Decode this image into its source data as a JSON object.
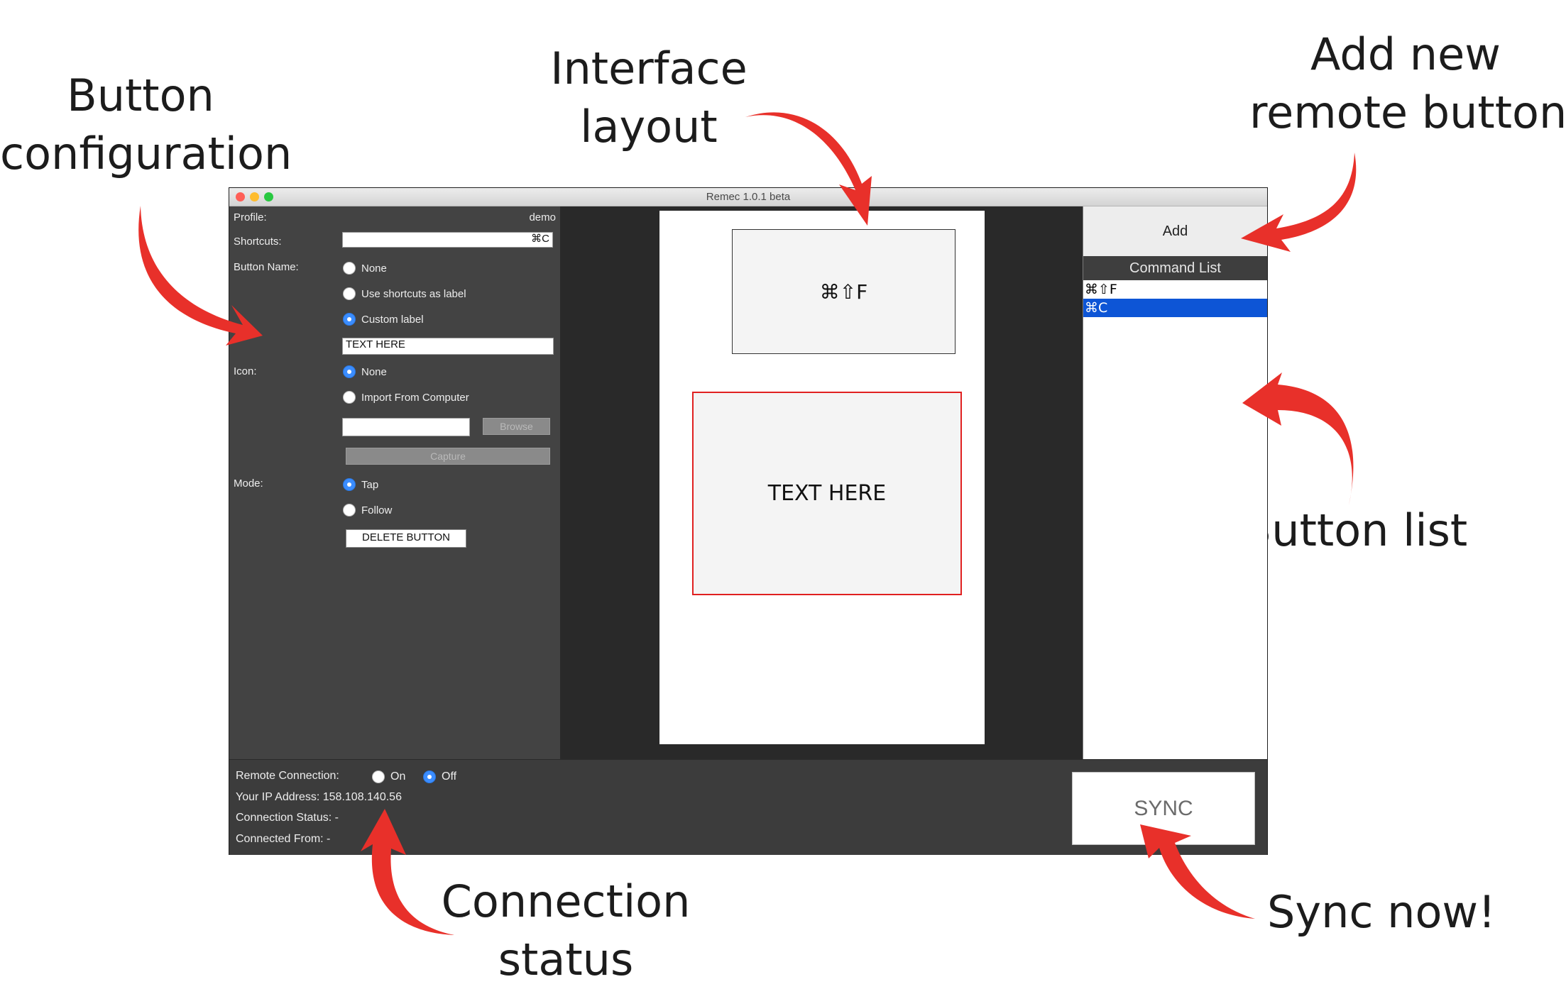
{
  "annotations": {
    "button_configuration": [
      "Button",
      "configuration"
    ],
    "interface_layout": [
      "Interface",
      "layout"
    ],
    "add_new_remote_button": [
      "Add new",
      "remote button"
    ],
    "button_list": "Button list",
    "connection_status": [
      "Connection",
      "status"
    ],
    "sync_now": "Sync now!"
  },
  "window": {
    "title": "Remec 1.0.1 beta",
    "traffic_light_colors": [
      "#ff5f57",
      "#febc2e",
      "#28c840"
    ]
  },
  "config_panel": {
    "profile_label": "Profile:",
    "profile_value": "demo",
    "shortcuts_label": "Shortcuts:",
    "shortcuts_value": "⌘C",
    "button_name_label": "Button Name:",
    "button_name_options": [
      {
        "label": "None",
        "selected": false
      },
      {
        "label": "Use shortcuts as label",
        "selected": false
      },
      {
        "label": "Custom label",
        "selected": true
      }
    ],
    "custom_label_value": "TEXT HERE",
    "icon_label": "Icon:",
    "icon_options": [
      {
        "label": "None",
        "selected": true
      },
      {
        "label": "Import From Computer",
        "selected": false
      }
    ],
    "icon_path_value": "",
    "browse_label": "Browse",
    "capture_label": "Capture",
    "mode_label": "Mode:",
    "mode_options": [
      {
        "label": "Tap",
        "selected": true
      },
      {
        "label": "Follow",
        "selected": false
      }
    ],
    "delete_button_label": "DELETE BUTTON"
  },
  "layout_preview": {
    "buttons": [
      {
        "label": "⌘⇧F",
        "selected": false
      },
      {
        "label": "TEXT HERE",
        "selected": true
      }
    ],
    "selected_border_color": "#e02020"
  },
  "command_panel": {
    "add_label": "Add",
    "list_header": "Command List",
    "items": [
      {
        "label": "⌘⇧F",
        "selected": false
      },
      {
        "label": "⌘C",
        "selected": true
      }
    ],
    "selection_color": "#0d55d6"
  },
  "connection": {
    "remote_connection_label": "Remote Connection:",
    "on_label": "On",
    "off_label": "Off",
    "state": "Off",
    "ip_line": "Your IP Address: 158.108.140.56",
    "status_line": "Connection Status: -",
    "from_line": "Connected From: -"
  },
  "sync_label": "SYNC",
  "accent_color": "#e8302a"
}
